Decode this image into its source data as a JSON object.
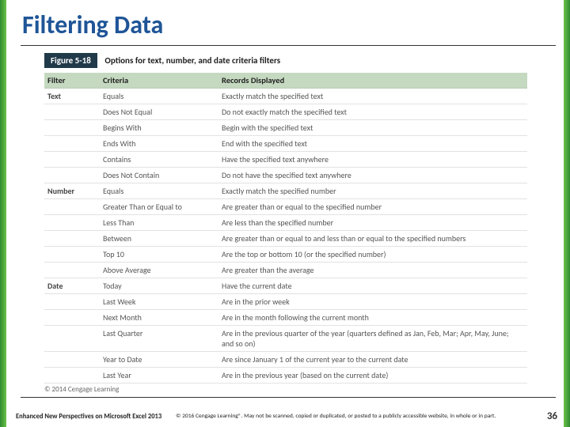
{
  "title": "Filtering Data",
  "figure": {
    "label": "Figure 5-18",
    "caption": "Options for text, number, and date criteria filters"
  },
  "table": {
    "headers": [
      "Filter",
      "Criteria",
      "Records Displayed"
    ],
    "rows": [
      {
        "filter": "Text",
        "criteria": "Equals",
        "desc": "Exactly match the specified text"
      },
      {
        "filter": "",
        "criteria": "Does Not Equal",
        "desc": "Do not exactly match the specified text"
      },
      {
        "filter": "",
        "criteria": "Begins With",
        "desc": "Begin with the specified text"
      },
      {
        "filter": "",
        "criteria": "Ends With",
        "desc": "End with the specified text"
      },
      {
        "filter": "",
        "criteria": "Contains",
        "desc": "Have the specified text anywhere"
      },
      {
        "filter": "",
        "criteria": "Does Not Contain",
        "desc": "Do not have the specified text anywhere"
      },
      {
        "filter": "Number",
        "criteria": "Equals",
        "desc": "Exactly match the specified number"
      },
      {
        "filter": "",
        "criteria": "Greater Than or Equal to",
        "desc": "Are greater than or equal to the specified number"
      },
      {
        "filter": "",
        "criteria": "Less Than",
        "desc": "Are less than the specified number"
      },
      {
        "filter": "",
        "criteria": "Between",
        "desc": "Are greater than or equal to and less than or equal to the specified numbers"
      },
      {
        "filter": "",
        "criteria": "Top 10",
        "desc": "Are the top or bottom 10 (or the specified number)"
      },
      {
        "filter": "",
        "criteria": "Above Average",
        "desc": "Are greater than the average"
      },
      {
        "filter": "Date",
        "criteria": "Today",
        "desc": "Have the current date"
      },
      {
        "filter": "",
        "criteria": "Last Week",
        "desc": "Are in the prior week"
      },
      {
        "filter": "",
        "criteria": "Next Month",
        "desc": "Are in the month following the current month"
      },
      {
        "filter": "",
        "criteria": "Last Quarter",
        "desc": "Are in the previous quarter of the year (quarters defined as Jan, Feb, Mar; Apr, May, June; and so on)"
      },
      {
        "filter": "",
        "criteria": "Year to Date",
        "desc": "Are since January 1 of the current year to the current date"
      },
      {
        "filter": "",
        "criteria": "Last Year",
        "desc": "Are in the previous year (based on the current date)"
      }
    ],
    "copyright": "© 2014 Cengage Learning"
  },
  "footer": {
    "book": "Enhanced New Perspectives on Microsoft Excel 2013",
    "legal": "© 2016 Cengage Learning®. May not be scanned, copied or duplicated, or posted to a publicly accessible website, in whole or in part.",
    "page": "36"
  }
}
